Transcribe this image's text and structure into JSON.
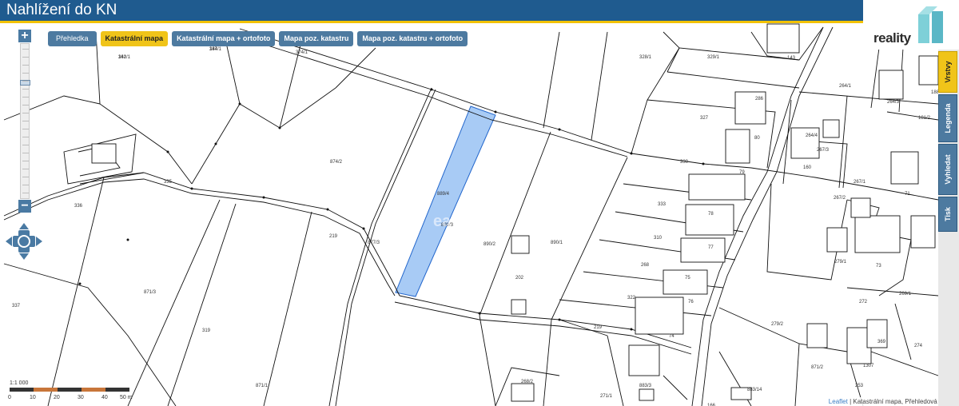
{
  "header": {
    "title": "Nahlížení do KN"
  },
  "logo": {
    "text": "reality",
    "icon": "reality-logo-icon"
  },
  "layers": [
    {
      "label": "Přehledka",
      "active": false
    },
    {
      "label": "Katastrální mapa",
      "active": true
    },
    {
      "label": "Katastrální mapa + ortofoto",
      "active": false
    },
    {
      "label": "Mapa poz. katastru",
      "active": false
    },
    {
      "label": "Mapa poz. katastru + ortofoto",
      "active": false
    }
  ],
  "side_tabs": [
    {
      "label": "Vrstvy",
      "active": true
    },
    {
      "label": "Legenda",
      "active": false
    },
    {
      "label": "Vyhledat",
      "active": false
    },
    {
      "label": "Tisk",
      "active": false
    }
  ],
  "zoom": {
    "in_label": "+",
    "out_label": "−"
  },
  "scale": {
    "ratio": "1:1 000",
    "ticks": [
      "0",
      "10",
      "20",
      "30",
      "40",
      "50 m"
    ]
  },
  "attribution": {
    "link": "Leaflet",
    "text": "| Katastrální mapa, Přehledová mapa"
  },
  "watermark": "ea",
  "map": {
    "parcel_labels": [
      "342/1",
      "344/1",
      "374/1",
      "328/1",
      "329/1",
      "143",
      "264/1",
      "264/3",
      "188",
      "286",
      "327",
      "80",
      "264/4",
      "267/3",
      "181/2",
      "330",
      "79",
      "267/1",
      "160",
      "71",
      "335",
      "874/2",
      "889/4",
      "336",
      "267/2",
      "333",
      "78",
      "310",
      "77",
      "890/3",
      "890/2",
      "890/1",
      "877/3",
      "219",
      "871/3",
      "268",
      "76",
      "279/1",
      "75",
      "322",
      "73",
      "272",
      "269/1",
      "337",
      "279/2",
      "202",
      "219",
      "74",
      "319",
      "871/1",
      "871/2",
      "369",
      "274",
      "268/2",
      "253",
      "883/14",
      "883/3",
      "271/1",
      "166",
      "308",
      "1307",
      "161",
      "187"
    ]
  }
}
